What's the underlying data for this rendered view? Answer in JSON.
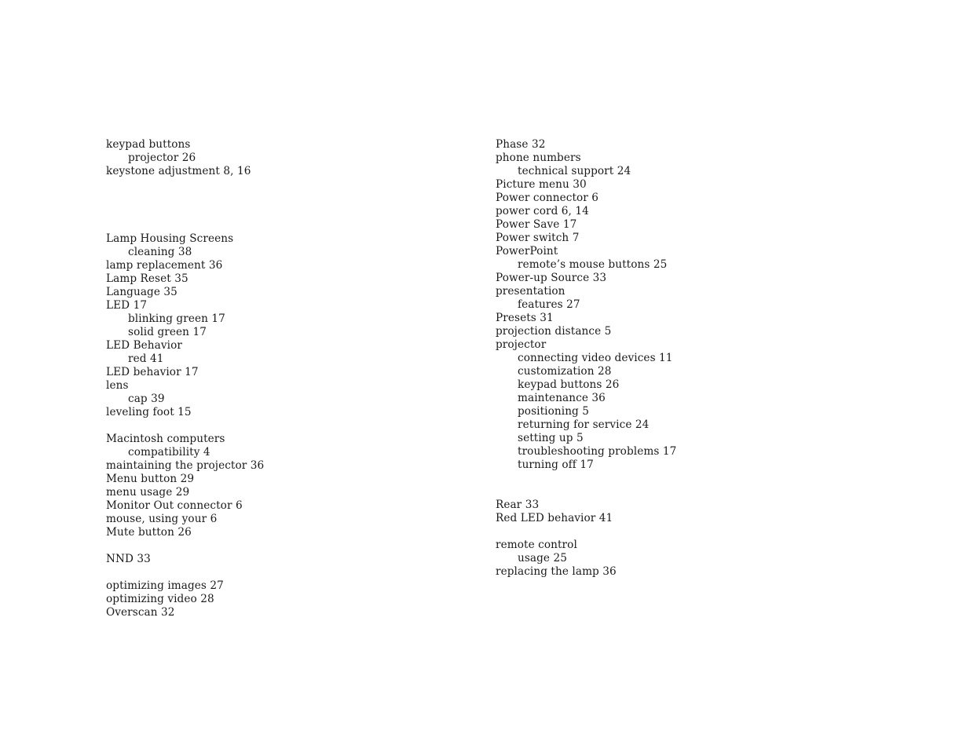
{
  "document": {
    "type": "index",
    "page_background": "#ffffff",
    "text_color": "#1a1a1a",
    "columns": 2
  },
  "left_column": {
    "blocks": [
      {
        "gap_before": "none",
        "entries": [
          {
            "text": "keypad buttons",
            "level": 0
          },
          {
            "text": "projector 26",
            "level": 1
          },
          {
            "text": "keystone adjustment 8, 16",
            "level": 0
          }
        ]
      },
      {
        "gap_before": "large",
        "entries": [
          {
            "text": "Lamp Housing Screens",
            "level": 0
          },
          {
            "text": "cleaning 38",
            "level": 1
          },
          {
            "text": "lamp replacement 36",
            "level": 0
          },
          {
            "text": "Lamp Reset 35",
            "level": 0
          },
          {
            "text": "Language 35",
            "level": 0
          },
          {
            "text": "LED 17",
            "level": 0
          },
          {
            "text": "blinking green 17",
            "level": 1
          },
          {
            "text": "solid green 17",
            "level": 1
          },
          {
            "text": "LED Behavior",
            "level": 0
          },
          {
            "text": "red 41",
            "level": 1
          },
          {
            "text": "LED behavior 17",
            "level": 0
          },
          {
            "text": "lens",
            "level": 0
          },
          {
            "text": "cap 39",
            "level": 1
          },
          {
            "text": "leveling foot 15",
            "level": 0
          }
        ]
      },
      {
        "gap_before": "single",
        "entries": [
          {
            "text": "Macintosh computers",
            "level": 0
          },
          {
            "text": "compatibility 4",
            "level": 1
          },
          {
            "text": "maintaining the projector 36",
            "level": 0
          },
          {
            "text": "Menu button 29",
            "level": 0
          },
          {
            "text": "menu usage 29",
            "level": 0
          },
          {
            "text": "Monitor Out connector 6",
            "level": 0
          },
          {
            "text": "mouse, using your 6",
            "level": 0
          },
          {
            "text": "Mute button 26",
            "level": 0
          }
        ]
      },
      {
        "gap_before": "single",
        "entries": [
          {
            "text": "NND 33",
            "level": 0
          }
        ]
      },
      {
        "gap_before": "single",
        "entries": [
          {
            "text": "optimizing images 27",
            "level": 0
          },
          {
            "text": "optimizing video 28",
            "level": 0
          },
          {
            "text": "Overscan 32",
            "level": 0
          }
        ]
      }
    ]
  },
  "right_column": {
    "blocks": [
      {
        "gap_before": "none",
        "entries": [
          {
            "text": "Phase 32",
            "level": 0
          },
          {
            "text": "phone numbers",
            "level": 0
          },
          {
            "text": "technical support 24",
            "level": 1
          },
          {
            "text": "Picture menu 30",
            "level": 0
          },
          {
            "text": "Power connector 6",
            "level": 0
          },
          {
            "text": "power cord 6, 14",
            "level": 0
          },
          {
            "text": "Power Save 17",
            "level": 0
          },
          {
            "text": "Power switch 7",
            "level": 0
          },
          {
            "text": "PowerPoint",
            "level": 0
          },
          {
            "text": "remote’s mouse buttons 25",
            "level": 1
          },
          {
            "text": "Power-up Source 33",
            "level": 0
          },
          {
            "text": "presentation",
            "level": 0
          },
          {
            "text": "features 27",
            "level": 1
          },
          {
            "text": "Presets 31",
            "level": 0
          },
          {
            "text": "projection distance 5",
            "level": 0
          },
          {
            "text": "projector",
            "level": 0
          },
          {
            "text": "connecting video devices 11",
            "level": 1
          },
          {
            "text": "customization 28",
            "level": 1
          },
          {
            "text": "keypad buttons 26",
            "level": 1
          },
          {
            "text": "maintenance 36",
            "level": 1
          },
          {
            "text": "positioning 5",
            "level": 1
          },
          {
            "text": "returning for service 24",
            "level": 1
          },
          {
            "text": "setting up 5",
            "level": 1
          },
          {
            "text": "troubleshooting problems 17",
            "level": 1
          },
          {
            "text": "turning off 17",
            "level": 1
          }
        ]
      },
      {
        "gap_before": "double",
        "entries": [
          {
            "text": "Rear 33",
            "level": 0
          },
          {
            "text": "Red LED behavior 41",
            "level": 0
          }
        ]
      },
      {
        "gap_before": "single",
        "entries": [
          {
            "text": "remote control",
            "level": 0
          },
          {
            "text": "usage 25",
            "level": 1
          },
          {
            "text": "replacing the lamp 36",
            "level": 0
          }
        ]
      }
    ]
  }
}
